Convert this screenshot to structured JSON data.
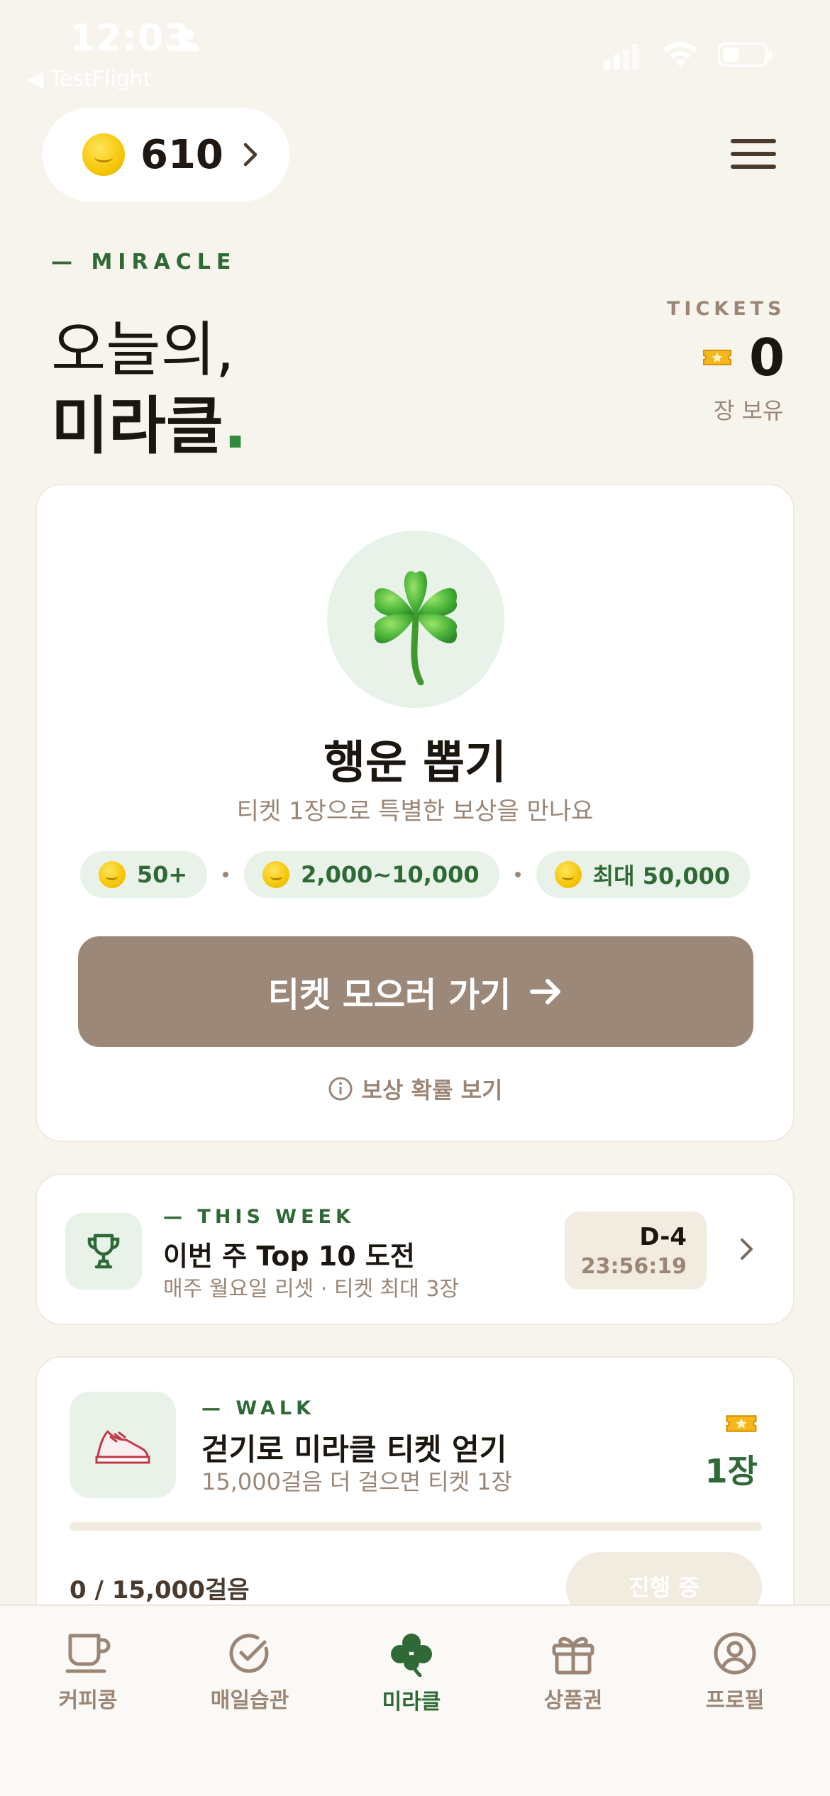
{
  "status_bar": {
    "time": "12:03",
    "back_app": "◀ TestFlight"
  },
  "header": {
    "coin_balance": "610"
  },
  "hero": {
    "kicker": "— MIRACLE",
    "title_line1": "오늘의,",
    "title_line2": "미라클",
    "title_dot": ".",
    "tickets_label": "TICKETS",
    "tickets_count": "0",
    "tickets_sub": "장 보유"
  },
  "draw_card": {
    "title": "행운 뽑기",
    "subtitle": "티켓 1장으로 특별한 보상을 만나요",
    "rewards": [
      "50+",
      "2,000~10,000",
      "최대 50,000"
    ],
    "cta_label": "티켓 모으러 가기",
    "odds_link": "보상 확률 보기"
  },
  "weekly_card": {
    "kicker": "— THIS WEEK",
    "title": "이번 주 Top 10 도전",
    "subtitle": "매주 월요일 리셋 · 티켓 최대 3장",
    "d_day": "D-4",
    "countdown": "23:56:19"
  },
  "walk_card": {
    "kicker": "— WALK",
    "title": "걷기로 미라클 티켓 얻기",
    "subtitle": "15,000걸음 더 걸으면 티켓 1장",
    "reward_count": "1장",
    "progress": 0,
    "steps": "0 / 15,000걸음",
    "status_button": "진행 중"
  },
  "tabs": [
    {
      "label": "커피콩",
      "icon": "coffee-cup-icon"
    },
    {
      "label": "매일습관",
      "icon": "check-circle-icon"
    },
    {
      "label": "미라클",
      "icon": "clover-icon",
      "active": true
    },
    {
      "label": "상품권",
      "icon": "gift-icon"
    },
    {
      "label": "프로필",
      "icon": "profile-icon"
    }
  ],
  "colors": {
    "background": "#f7f4ee",
    "accent_green": "#2f6a36",
    "cta_brown": "#9b8878",
    "muted_text": "#9b8676",
    "chip_green_bg": "#e8f2e8"
  }
}
